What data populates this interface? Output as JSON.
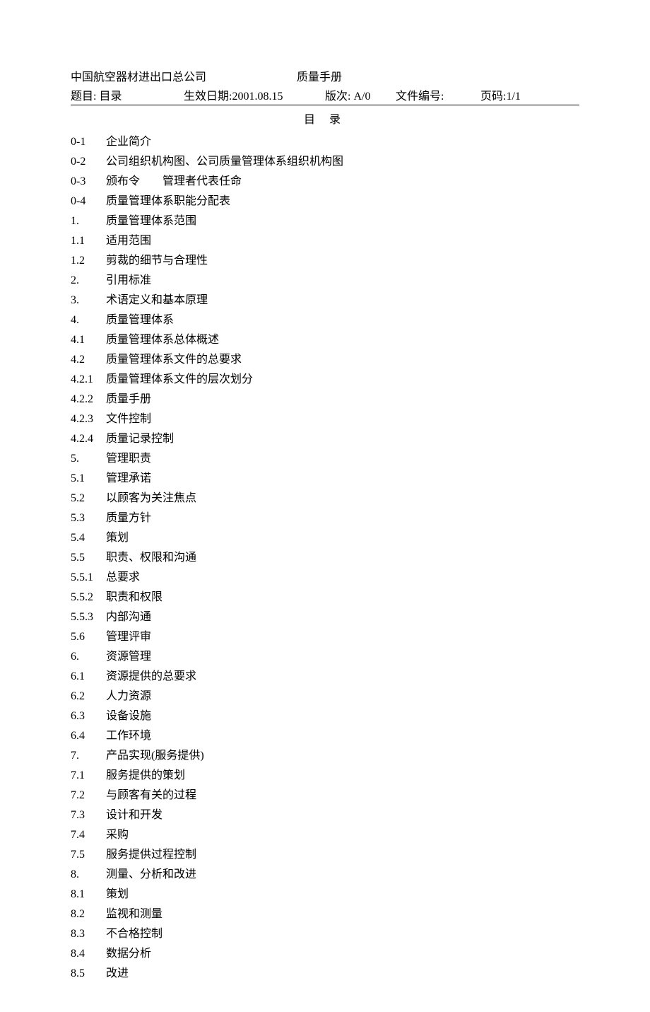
{
  "header": {
    "company": "中国航空器材进出口总公司",
    "manual": "质量手册",
    "subjectLabel": "题目:",
    "subjectValue": "目录",
    "effectiveDateLabel": "生效日期:",
    "effectiveDateValue": "2001.08.15",
    "versionLabel": "版次:",
    "versionValue": "A/0",
    "docNoLabel": "文件编号:",
    "pageLabel": "页码:",
    "pageValue": "1/1"
  },
  "title": "目 录",
  "toc": [
    {
      "num": "0-1",
      "text": "企业简介"
    },
    {
      "num": "0-2",
      "text": "公司组织机构图、公司质量管理体系组织机构图"
    },
    {
      "num": "0-3",
      "text": "颁布令  管理者代表任命"
    },
    {
      "num": "0-4",
      "text": "质量管理体系职能分配表"
    },
    {
      "num": "1.",
      "text": "质量管理体系范围"
    },
    {
      "num": "1.1",
      "text": "适用范围"
    },
    {
      "num": "1.2",
      "text": "剪裁的细节与合理性"
    },
    {
      "num": "2.",
      "text": "引用标准"
    },
    {
      "num": "3.",
      "text": "术语定义和基本原理"
    },
    {
      "num": "4.",
      "text": "质量管理体系"
    },
    {
      "num": "4.1",
      "text": "质量管理体系总体概述"
    },
    {
      "num": "4.2",
      "text": "质量管理体系文件的总要求"
    },
    {
      "num": "4.2.1",
      "text": "质量管理体系文件的层次划分"
    },
    {
      "num": "4.2.2",
      "text": "质量手册"
    },
    {
      "num": "4.2.3",
      "text": "文件控制"
    },
    {
      "num": "4.2.4",
      "text": "质量记录控制"
    },
    {
      "num": "5.",
      "text": "管理职责"
    },
    {
      "num": "5.1",
      "text": "管理承诺"
    },
    {
      "num": "5.2",
      "text": "以顾客为关注焦点"
    },
    {
      "num": "5.3",
      "text": "质量方针"
    },
    {
      "num": "5.4",
      "text": "策划"
    },
    {
      "num": "5.5",
      "text": "职责、权限和沟通"
    },
    {
      "num": "5.5.1",
      "text": "总要求"
    },
    {
      "num": "5.5.2",
      "text": "职责和权限"
    },
    {
      "num": "5.5.3",
      "text": "内部沟通"
    },
    {
      "num": "5.6",
      "text": "管理评审"
    },
    {
      "num": "6.",
      "text": "资源管理"
    },
    {
      "num": "6.1",
      "text": "资源提供的总要求"
    },
    {
      "num": "6.2",
      "text": "人力资源"
    },
    {
      "num": "6.3",
      "text": "设备设施"
    },
    {
      "num": "6.4",
      "text": "工作环境"
    },
    {
      "num": "7.",
      "text": "产品实现(服务提供)"
    },
    {
      "num": "7.1",
      "text": "服务提供的策划"
    },
    {
      "num": "7.2",
      "text": "与顾客有关的过程"
    },
    {
      "num": "7.3",
      "text": "设计和开发"
    },
    {
      "num": "7.4",
      "text": "采购"
    },
    {
      "num": "7.5",
      "text": "服务提供过程控制"
    },
    {
      "num": "8.",
      "text": "测量、分析和改进"
    },
    {
      "num": "8.1",
      "text": "策划"
    },
    {
      "num": "8.2",
      "text": "监视和测量"
    },
    {
      "num": "8.3",
      "text": "不合格控制"
    },
    {
      "num": "8.4",
      "text": "数据分析"
    },
    {
      "num": "8.5",
      "text": "改进"
    }
  ]
}
